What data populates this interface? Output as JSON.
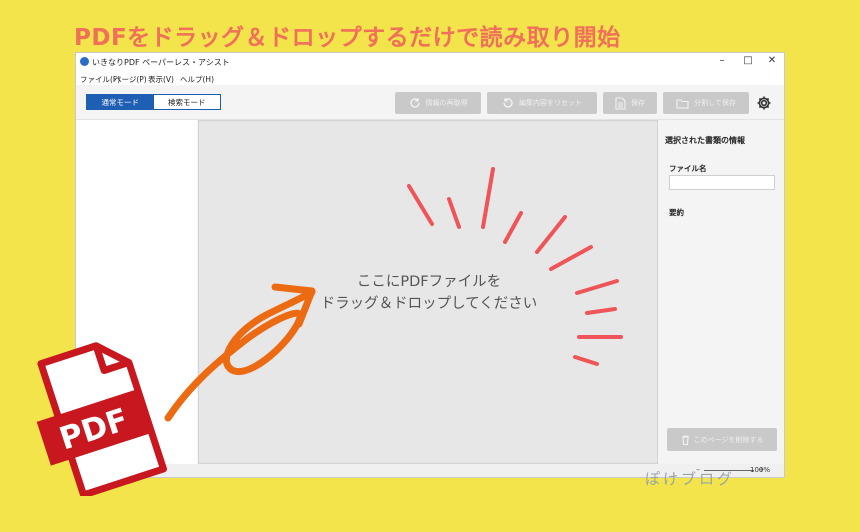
{
  "headline": "PDFをドラッグ＆ドロップするだけで読み取り開始",
  "window": {
    "title": "いきなりPDF ペーパーレス・アシスト",
    "controls": {
      "minimize": "–",
      "maximize": "□",
      "close": "✕"
    }
  },
  "menu": [
    "ファイル(F)",
    "ページ(P)",
    "表示(V)",
    "ヘルプ(H)"
  ],
  "toolbar": {
    "mode_normal": "通常モード",
    "mode_search": "検索モード",
    "reacquire": "情報の再取得",
    "reset": "編集内容をリセット",
    "save": "保存",
    "split_save": "分割して保存"
  },
  "dropzone": {
    "line1": "ここにPDFファイルを",
    "line2": "ドラッグ＆ドロップしてください"
  },
  "right_panel": {
    "title": "選択された書類の情報",
    "filename_label": "ファイル名",
    "filename_value": "",
    "summary_label": "要約",
    "delete_button": "このページを削除する"
  },
  "status": {
    "zoom": "100%"
  },
  "overlay": {
    "pdf_icon_text": "PDF",
    "blog_logo": "ぽけブログ"
  },
  "colors": {
    "background": "#f2e44a",
    "headline": "#f0705a",
    "accent": "#1f5fb3",
    "arrow": "#ec6a12",
    "pdf_red": "#c8171e",
    "rays": "#ef5458"
  }
}
